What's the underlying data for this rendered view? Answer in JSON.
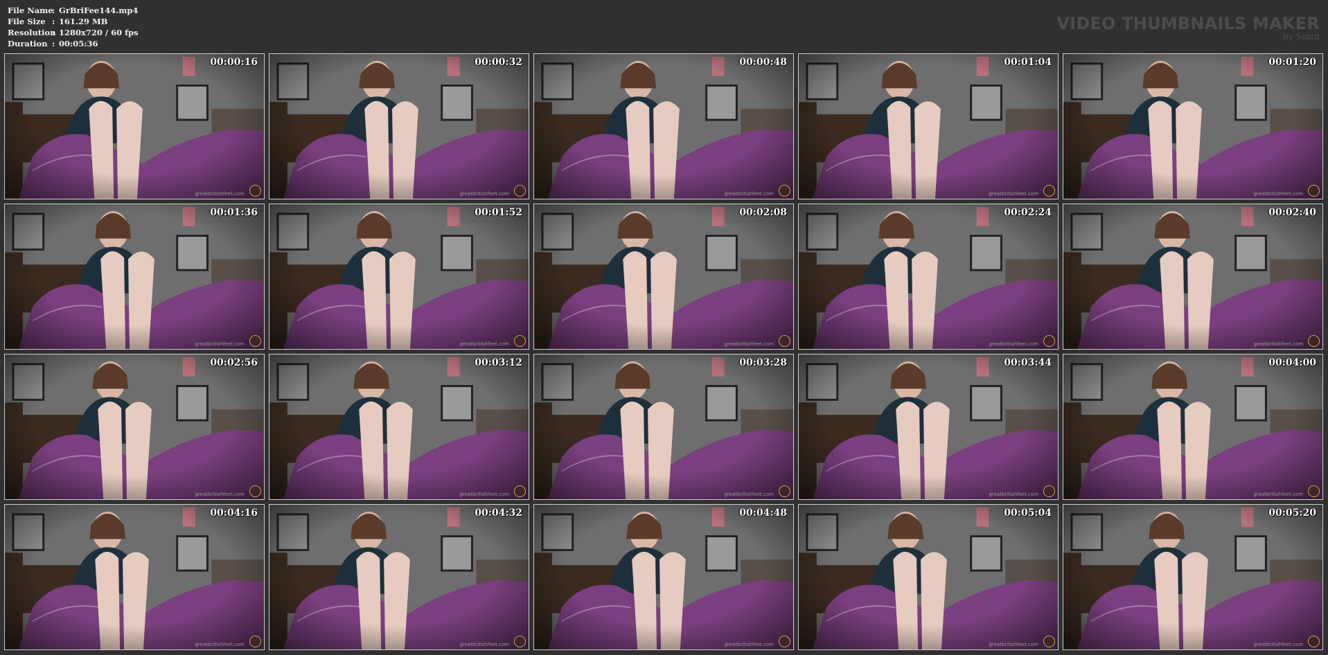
{
  "info": {
    "rows": [
      {
        "key": "File Name",
        "sep": ":",
        "value": "GrBriFee144.mp4"
      },
      {
        "key": "File Size",
        "sep": ":",
        "value": "161.29 MB"
      },
      {
        "key": "Resolution",
        "sep": ":",
        "value": "1280x720 / 60 fps"
      },
      {
        "key": "Duration",
        "sep": ":",
        "value": "00:05:36"
      }
    ]
  },
  "brand": {
    "title": "VIDEO THUMBNAILS MAKER",
    "subtitle": "by Scorp"
  },
  "thumbnails": [
    {
      "time": "00:00:16"
    },
    {
      "time": "00:00:32"
    },
    {
      "time": "00:00:48"
    },
    {
      "time": "00:01:04"
    },
    {
      "time": "00:01:20"
    },
    {
      "time": "00:01:36"
    },
    {
      "time": "00:01:52"
    },
    {
      "time": "00:02:08"
    },
    {
      "time": "00:02:24"
    },
    {
      "time": "00:02:40"
    },
    {
      "time": "00:02:56"
    },
    {
      "time": "00:03:12"
    },
    {
      "time": "00:03:28"
    },
    {
      "time": "00:03:44"
    },
    {
      "time": "00:04:00"
    },
    {
      "time": "00:04:16"
    },
    {
      "time": "00:04:32"
    },
    {
      "time": "00:04:48"
    },
    {
      "time": "00:05:04"
    },
    {
      "time": "00:05:20"
    }
  ],
  "watermark": "greatbritishfeet.com",
  "colors": {
    "background": "#303030",
    "wall": "#6e6e6e",
    "blanket": "#7a3f7f",
    "shirt": "#1d2f3a",
    "skin": "#d9b8a6"
  }
}
